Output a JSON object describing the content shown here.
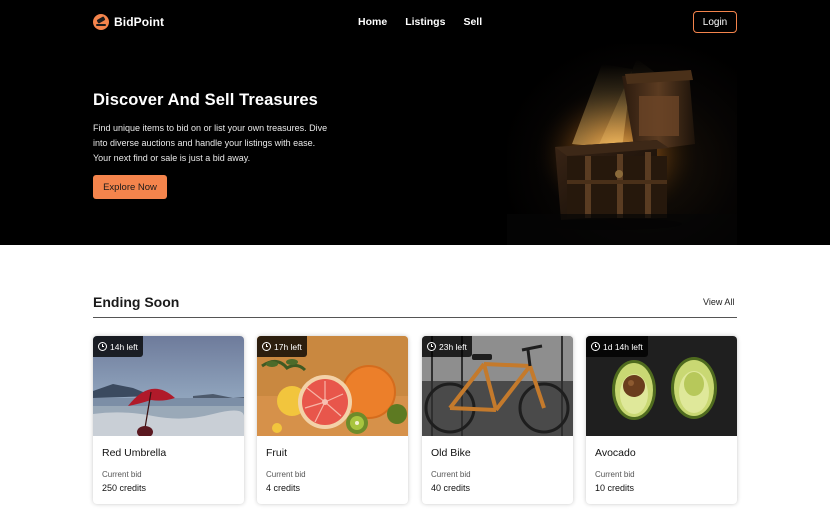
{
  "header": {
    "brand": "BidPoint",
    "nav": [
      "Home",
      "Listings",
      "Sell"
    ],
    "login_label": "Login"
  },
  "hero": {
    "title": "Discover And Sell Treasures",
    "text": "Find unique items to bid on or list your own treasures. Dive into diverse auctions and handle your listings with ease. Your next find or sale is just a bid away.",
    "cta_label": "Explore Now"
  },
  "ending_soon": {
    "title": "Ending Soon",
    "view_all_label": "View All",
    "cards": [
      {
        "time_left": "14h left",
        "title": "Red Umbrella",
        "bid_label": "Current bid",
        "bid_value": "250 credits"
      },
      {
        "time_left": "17h left",
        "title": "Fruit",
        "bid_label": "Current bid",
        "bid_value": "4 credits"
      },
      {
        "time_left": "23h left",
        "title": "Old Bike",
        "bid_label": "Current bid",
        "bid_value": "40 credits"
      },
      {
        "time_left": "1d 14h left",
        "title": "Avocado",
        "bid_label": "Current bid",
        "bid_value": "10 credits"
      }
    ]
  },
  "colors": {
    "accent": "#f4844c",
    "hero_background": "#000000"
  },
  "icons": [
    "gavel-logo-icon",
    "clock-icon",
    "treasure-chest-image"
  ]
}
